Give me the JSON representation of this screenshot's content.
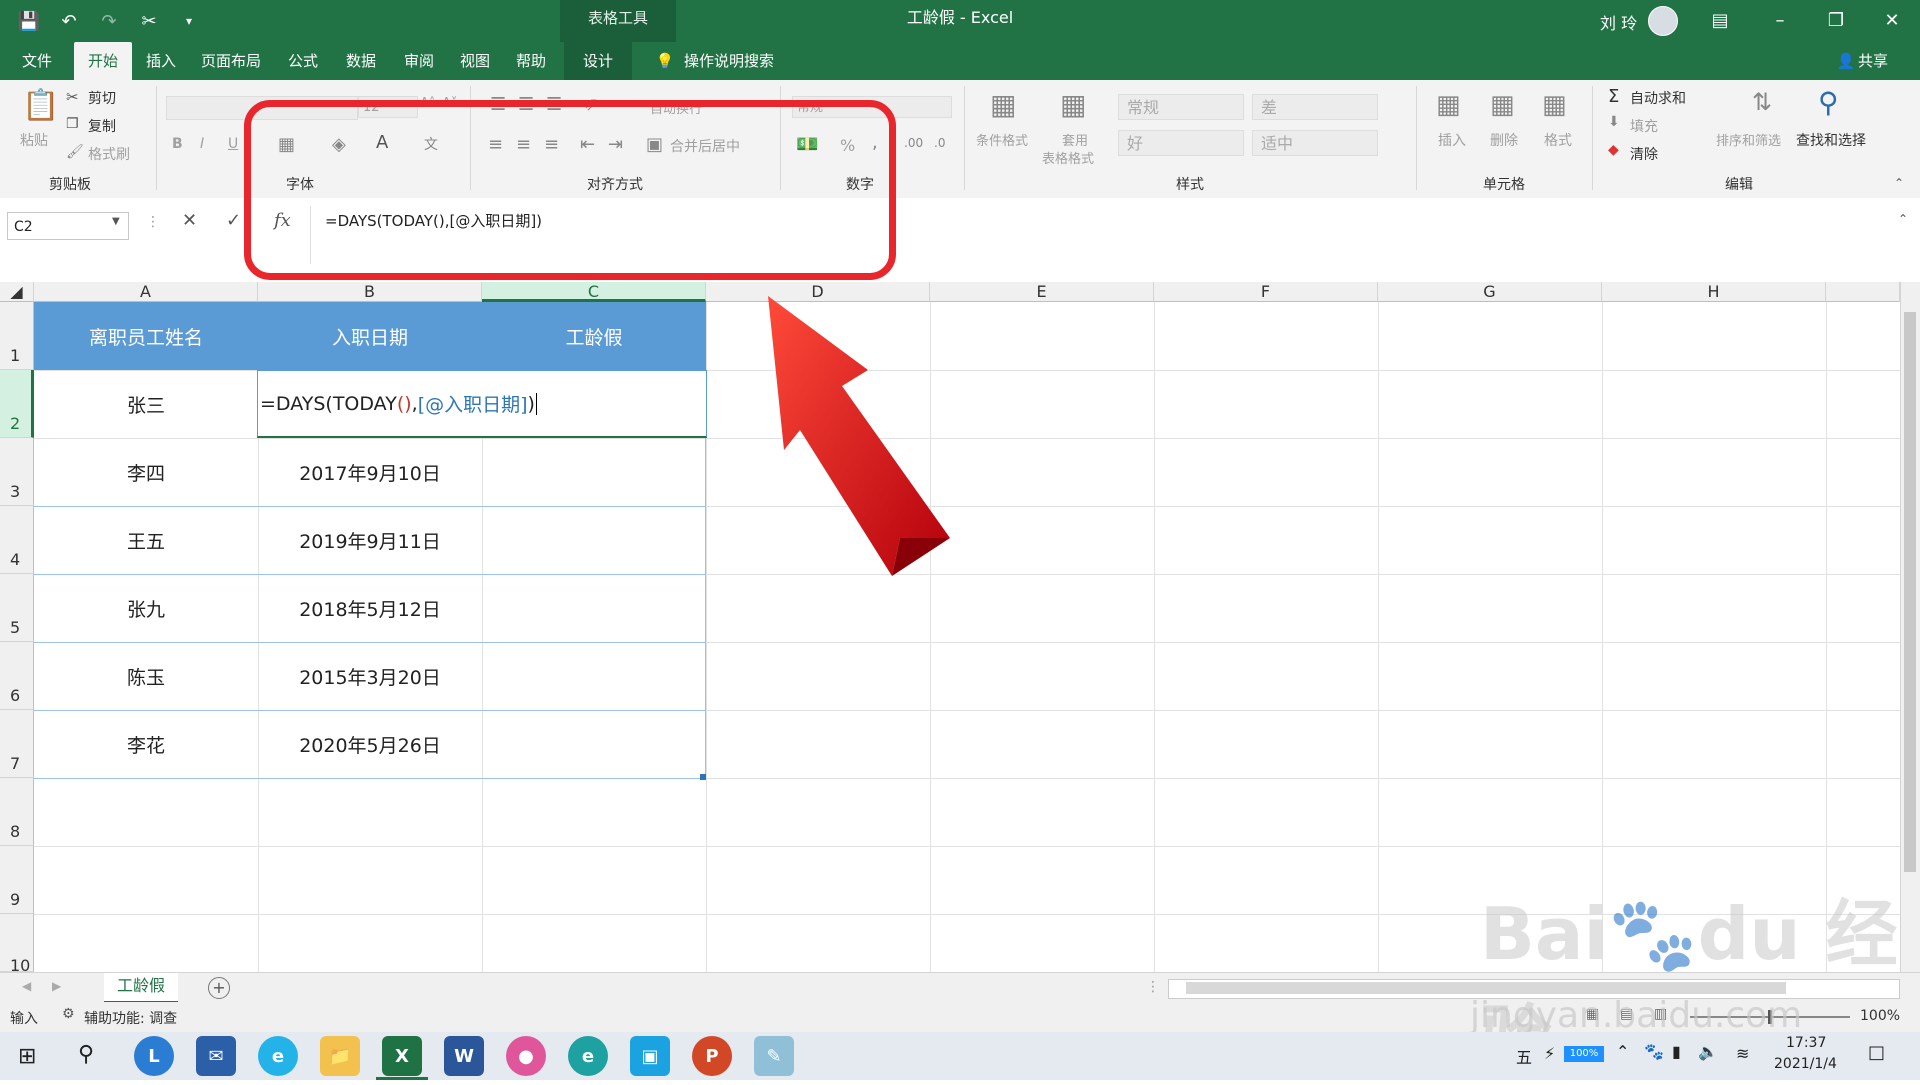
{
  "title_bar": {
    "context_tools": "表格工具",
    "document_title": "工龄假 - Excel",
    "user_name": "刘 玲"
  },
  "tabs": [
    "文件",
    "开始",
    "插入",
    "页面布局",
    "公式",
    "数据",
    "审阅",
    "视图",
    "帮助",
    "设计"
  ],
  "tell_me": "操作说明搜索",
  "share": "共享",
  "ribbon": {
    "clipboard": {
      "paste": "粘贴",
      "cut": "剪切",
      "copy": "复制",
      "format_painter": "格式刷",
      "label": "剪贴板"
    },
    "font": {
      "size": "12",
      "bold": "B",
      "italic": "I",
      "underline": "U",
      "label": "字体"
    },
    "alignment": {
      "wrap": "自动换行",
      "merge": "合并后居中",
      "label": "对齐方式"
    },
    "number": {
      "format": "常规",
      "percent": "%",
      "label": "数字"
    },
    "styles": {
      "conditional": "条件格式",
      "table_format_1": "套用",
      "table_format_2": "表格格式",
      "normal": "常规",
      "bad": "差",
      "good": "好",
      "neutral": "适中",
      "label": "样式"
    },
    "cells": {
      "insert": "插入",
      "delete": "删除",
      "format": "格式",
      "label": "单元格"
    },
    "editing": {
      "autosum": "自动求和",
      "fill": "填充",
      "clear": "清除",
      "sort": "排序和筛选",
      "find": "查找和选择",
      "label": "编辑"
    }
  },
  "formula_bar": {
    "name_box": "C2",
    "fx": "fx",
    "formula": "=DAYS(TODAY(),[@入职日期])"
  },
  "columns": [
    "A",
    "B",
    "C",
    "D",
    "E",
    "F",
    "G",
    "H"
  ],
  "rows": [
    "1",
    "2",
    "3",
    "4",
    "5",
    "6",
    "7",
    "8",
    "9",
    "10"
  ],
  "table": {
    "headers": [
      "离职员工姓名",
      "入职日期",
      "工龄假"
    ],
    "editing": {
      "name": "张三",
      "f_prefix": "=DAYS(TODAY",
      "f_paren": "()",
      "f_comma": ",",
      "f_ref": "[@入职日期]",
      "f_close": ")"
    },
    "rows": [
      {
        "name": "李四",
        "date": "2017年9月10日"
      },
      {
        "name": "王五",
        "date": "2019年9月11日"
      },
      {
        "name": "张九",
        "date": "2018年5月12日"
      },
      {
        "name": "陈玉",
        "date": "2015年3月20日"
      },
      {
        "name": "李花",
        "date": "2020年5月26日"
      }
    ]
  },
  "sheet_tab": "工龄假",
  "status": {
    "mode": "输入",
    "accessibility": "辅助功能: 调查",
    "zoom": "100%"
  },
  "taskbar": {
    "time": "17:37",
    "date": "2021/1/4",
    "ime": "五",
    "battery": "100%"
  },
  "watermark": "jingyan.baidu.com",
  "colors": {
    "excel_green": "#217346",
    "table_header": "#5b9bd5",
    "highlight_red": "#e8262c"
  }
}
